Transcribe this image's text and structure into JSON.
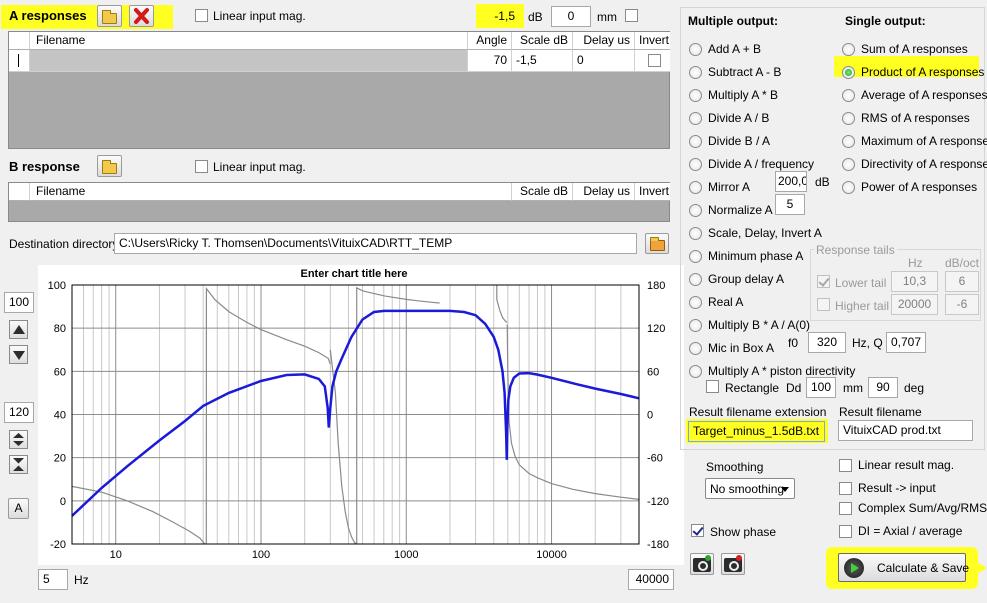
{
  "a_responses": {
    "title": "A responses",
    "linear_label": "Linear input mag.",
    "columns": [
      "Filename",
      "Angle",
      "Scale dB",
      "Delay us",
      "Invert"
    ],
    "row": {
      "filename": "",
      "angle": "70",
      "scale": "-1,5",
      "delay": "0"
    }
  },
  "offset": {
    "db_value": "-1,5",
    "db_unit": "dB",
    "mm_value": "0",
    "mm_unit": "mm"
  },
  "b_response": {
    "title": "B response",
    "linear_label": "Linear input mag.",
    "columns": [
      "Filename",
      "Scale dB",
      "Delay us",
      "Invert"
    ]
  },
  "destination": {
    "label": "Destination directory",
    "path": "C:\\Users\\Ricky T. Thomsen\\Documents\\VituixCAD\\RTT_TEMP"
  },
  "chart": {
    "top_value": "100",
    "mid_value": "120",
    "a_button": "A",
    "x_min": "5",
    "x_unit": "Hz",
    "x_max": "40000"
  },
  "chart_data": {
    "type": "line",
    "title": "Enter chart title here",
    "x_scale": "log",
    "xlim": [
      5,
      40000
    ],
    "ylim": [
      -20,
      100
    ],
    "y2lim": [
      -180,
      180
    ],
    "x_ticks": [
      10,
      100,
      1000,
      10000
    ],
    "x_tick_labels": [
      "10",
      "100",
      "1000",
      "10000"
    ],
    "y_ticks": [
      -20,
      0,
      20,
      40,
      60,
      80,
      100
    ],
    "y_tick_labels": [
      "-20",
      "0",
      "20",
      "40",
      "60",
      "80",
      "100"
    ],
    "y2_ticks": [
      -180,
      -120,
      -60,
      0,
      60,
      120,
      180
    ],
    "y2_tick_labels": [
      "-180",
      "-120",
      "-60",
      "0",
      "60",
      "120",
      "180"
    ],
    "grid": true,
    "magnitude": {
      "color": "#1a1ad8",
      "x": [
        5,
        8,
        12,
        20,
        30,
        40,
        60,
        100,
        150,
        200,
        250,
        275,
        288,
        293,
        300,
        310,
        330,
        360,
        420,
        500,
        600,
        700,
        1000,
        1500,
        2000,
        2500,
        3000,
        3500,
        4000,
        4300,
        4600,
        4750,
        4870,
        4920,
        4970,
        5050,
        5200,
        5500,
        6000,
        7000,
        8000,
        10000,
        15000,
        20000,
        30000,
        40000
      ],
      "y": [
        -7,
        6,
        16,
        28,
        37,
        44,
        50,
        55.5,
        58.3,
        58.6,
        56.5,
        53,
        43,
        34,
        43,
        53,
        60,
        66,
        76,
        84,
        87.5,
        88,
        88,
        88,
        88,
        87.5,
        86,
        82,
        76,
        70,
        60,
        50,
        32,
        19,
        36,
        47,
        53,
        57,
        59,
        59.2,
        58.5,
        57,
        54,
        52,
        49.5,
        47.5
      ]
    },
    "phase": {
      "color": "#8a8a8a",
      "segments": [
        {
          "x": [
            5,
            8,
            12,
            18,
            25,
            32,
            38,
            41
          ],
          "y": [
            -100,
            -108,
            -120,
            -135,
            -150,
            -162,
            -172,
            -180
          ]
        },
        {
          "x": [
            42,
            42.1,
            48,
            60,
            80,
            100,
            150,
            200,
            250,
            290,
            300
          ],
          "y": [
            -180,
            175,
            160,
            143,
            128,
            118,
            104,
            95,
            86,
            78,
            70
          ]
        },
        {
          "x": [
            300,
            325,
            340,
            360,
            380,
            400,
            420,
            440,
            455
          ],
          "y": [
            90,
            30,
            -40,
            -100,
            -135,
            -158,
            -170,
            -178,
            -180
          ]
        },
        {
          "x": [
            456,
            456.1,
            500,
            600,
            700,
            800,
            1000,
            1200,
            1500,
            1700
          ],
          "y": [
            -180,
            176,
            172,
            168,
            165,
            163,
            160,
            158,
            156,
            155
          ]
        },
        {
          "x": [
            4200,
            4200.1,
            4400,
            4600,
            4800,
            4950
          ],
          "y": [
            180,
            160,
            145,
            135,
            130,
            128
          ]
        },
        {
          "x": [
            4950,
            5000,
            5100,
            5300,
            5600,
            6000,
            7000,
            8000,
            10000,
            14000,
            20000,
            30000,
            40000
          ],
          "y": [
            125,
            60,
            -10,
            -40,
            -58,
            -70,
            -82,
            -88,
            -96,
            -104,
            -110,
            -115,
            -118
          ]
        }
      ]
    }
  },
  "multiple_output": {
    "heading": "Multiple output:",
    "options": [
      "Add A + B",
      "Subtract A - B",
      "Multiply A * B",
      "Divide A / B",
      "Divide B / A",
      "Divide A / frequency",
      "Mirror A",
      "Normalize A",
      "Scale, Delay, Invert A",
      "Minimum phase A",
      "Group delay A",
      "Real A",
      "Multiply B * A / A(0)",
      "Mic in Box A",
      "Multiply A * piston directivity"
    ],
    "mirror_value": "200,0",
    "mirror_unit": "dB",
    "normalize_value": "5",
    "mic_f0_label": "f0",
    "mic_f0_value": "320",
    "mic_q_label": "Hz, Q",
    "mic_q_value": "0,707",
    "rectangle_label": "Rectangle",
    "rectangle_dd_label": "Dd",
    "rectangle_dd_value": "100",
    "rectangle_mm": "mm",
    "rectangle_deg_value": "90",
    "rectangle_deg": "deg"
  },
  "single_output": {
    "heading": "Single output:",
    "options": [
      "Sum of A responses",
      "Product of A responses",
      "Average of A responses",
      "RMS of A responses",
      "Maximum of A responses",
      "Directivity of A responses",
      "Power of A responses"
    ],
    "selected_index": 1
  },
  "response_tails": {
    "title": "Response tails",
    "hz_header": "Hz",
    "dboct_header": "dB/oct",
    "lower_label": "Lower tail",
    "lower_hz": "10,3",
    "lower_db": "6",
    "higher_label": "Higher tail",
    "higher_hz": "20000",
    "higher_db": "-6"
  },
  "result": {
    "ext_label": "Result filename extension",
    "ext_value": "Target_minus_1.5dB.txt",
    "name_label": "Result filename",
    "name_value": "VituixCAD prod.txt"
  },
  "smoothing": {
    "label": "Smoothing",
    "value": "No smoothing"
  },
  "show_phase": "Show phase",
  "options": [
    "Linear result mag.",
    "Result -> input",
    "Complex Sum/Avg/RMS",
    "DI = Axial / average"
  ],
  "calculate_button": "Calculate & Save",
  "colors": {
    "highlight": "#ffff22",
    "magnitude": "#1a1ad8",
    "phase": "#8a8a8a"
  }
}
